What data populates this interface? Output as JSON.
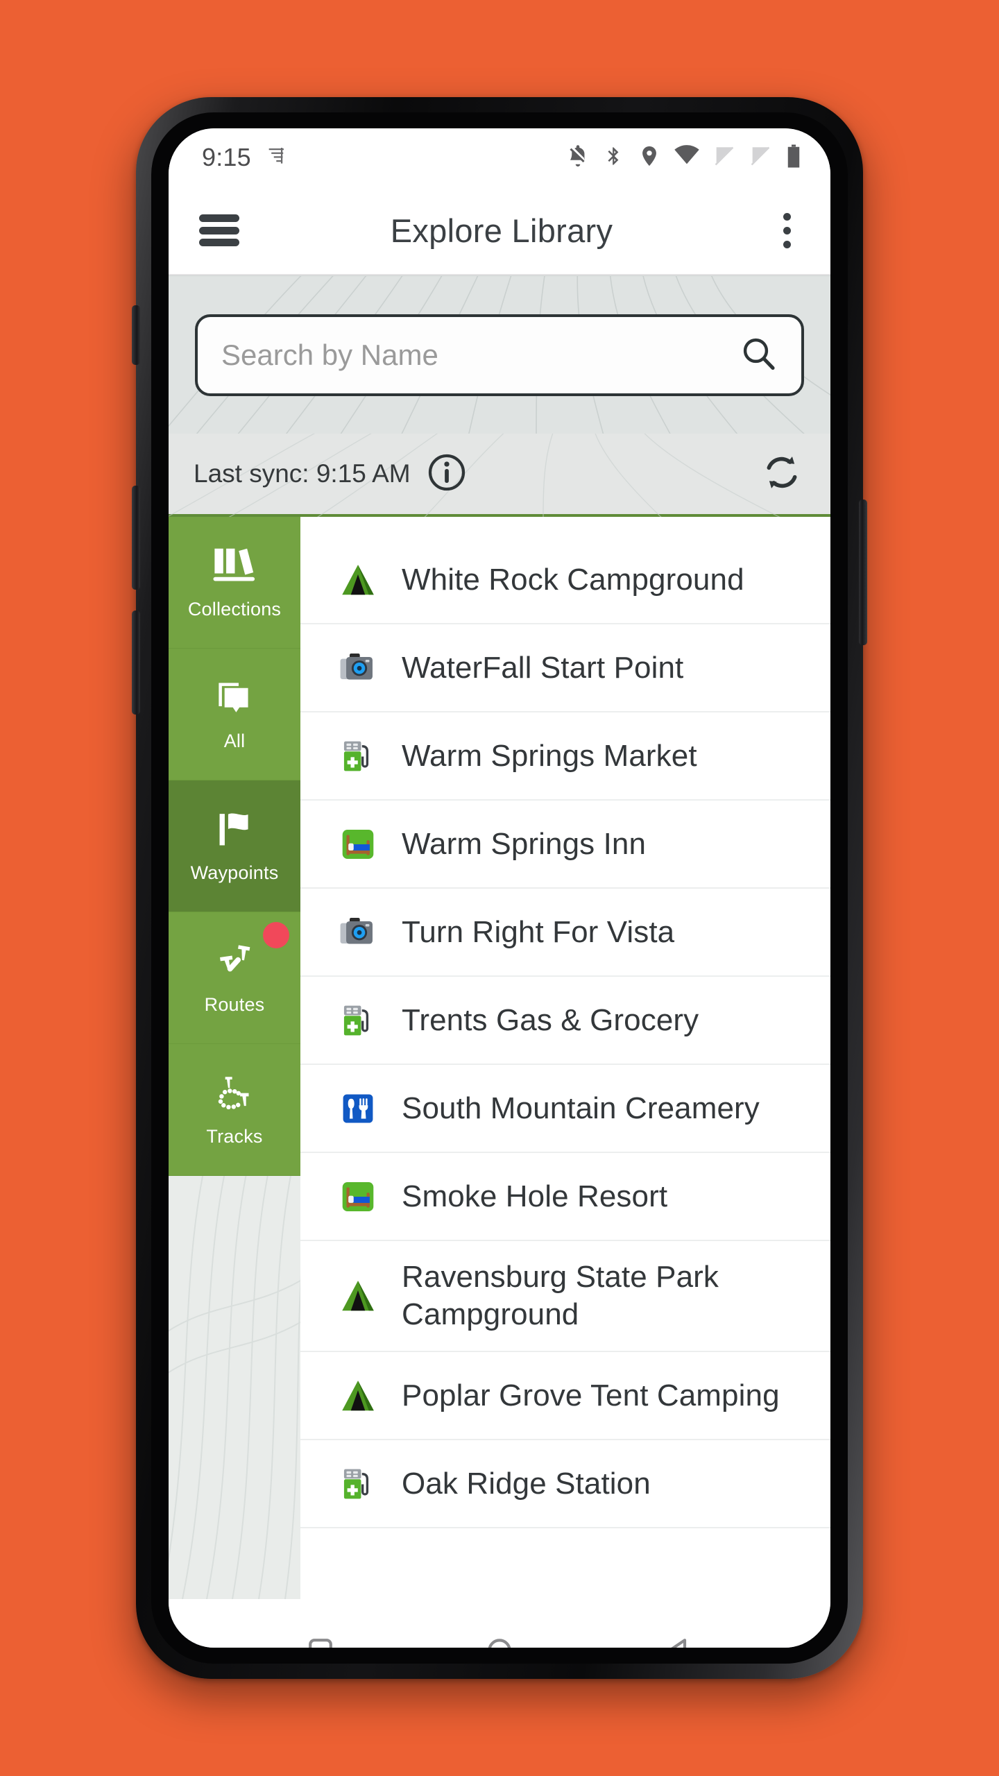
{
  "theme": {
    "page_background": "#EC6033",
    "accent_green": "#74A342",
    "accent_green_selected": "#5C8434",
    "divider_green": "#5F8C38",
    "badge_red": "#F1485A",
    "text_dark": "#33373A",
    "panel_grey": "#DFE3E2"
  },
  "status_bar": {
    "time": "9:15",
    "left_icons": [
      "signal-meter-icon"
    ],
    "right_icons": [
      "notifications-off-icon",
      "bluetooth-icon",
      "location-icon",
      "wifi-icon",
      "no-sim-1-icon",
      "no-sim-2-icon",
      "battery-icon"
    ]
  },
  "app_bar": {
    "menu_icon": "hamburger-menu-icon",
    "title": "Explore Library",
    "overflow_icon": "more-vertical-icon"
  },
  "search": {
    "placeholder": "Search by Name",
    "value": "",
    "icon": "search-icon"
  },
  "sync": {
    "label": "Last sync: 9:15 AM",
    "info_icon": "info-icon",
    "refresh_icon": "refresh-icon"
  },
  "sidebar": {
    "items": [
      {
        "label": "Collections",
        "icon": "books-icon",
        "selected": false,
        "badge": false
      },
      {
        "label": "All",
        "icon": "cards-pin-icon",
        "selected": false,
        "badge": false
      },
      {
        "label": "Waypoints",
        "icon": "flag-icon",
        "selected": true,
        "badge": false
      },
      {
        "label": "Routes",
        "icon": "route-pins-icon",
        "selected": false,
        "badge": true
      },
      {
        "label": "Tracks",
        "icon": "track-dots-icon",
        "selected": false,
        "badge": false
      }
    ]
  },
  "list": {
    "clipped_top_row_text": "partially scrolled row",
    "items": [
      {
        "name": "White Rock Campground",
        "icon": "tent-icon"
      },
      {
        "name": "WaterFall Start Point",
        "icon": "camera-icon"
      },
      {
        "name": "Warm Springs Market",
        "icon": "gas-pump-icon"
      },
      {
        "name": "Warm Springs Inn",
        "icon": "lodging-bed-icon"
      },
      {
        "name": "Turn Right For Vista",
        "icon": "camera-icon"
      },
      {
        "name": "Trents Gas & Grocery",
        "icon": "gas-pump-icon"
      },
      {
        "name": "South Mountain Creamery",
        "icon": "restaurant-icon"
      },
      {
        "name": "Smoke Hole Resort",
        "icon": "lodging-bed-icon"
      },
      {
        "name": "Ravensburg State Park Campground",
        "icon": "tent-icon"
      },
      {
        "name": "Poplar Grove Tent Camping",
        "icon": "tent-icon"
      },
      {
        "name": "Oak Ridge Station",
        "icon": "gas-pump-icon"
      }
    ]
  },
  "nav_bar": {
    "buttons": [
      "recents-square-icon",
      "home-circle-icon",
      "back-triangle-icon"
    ]
  }
}
